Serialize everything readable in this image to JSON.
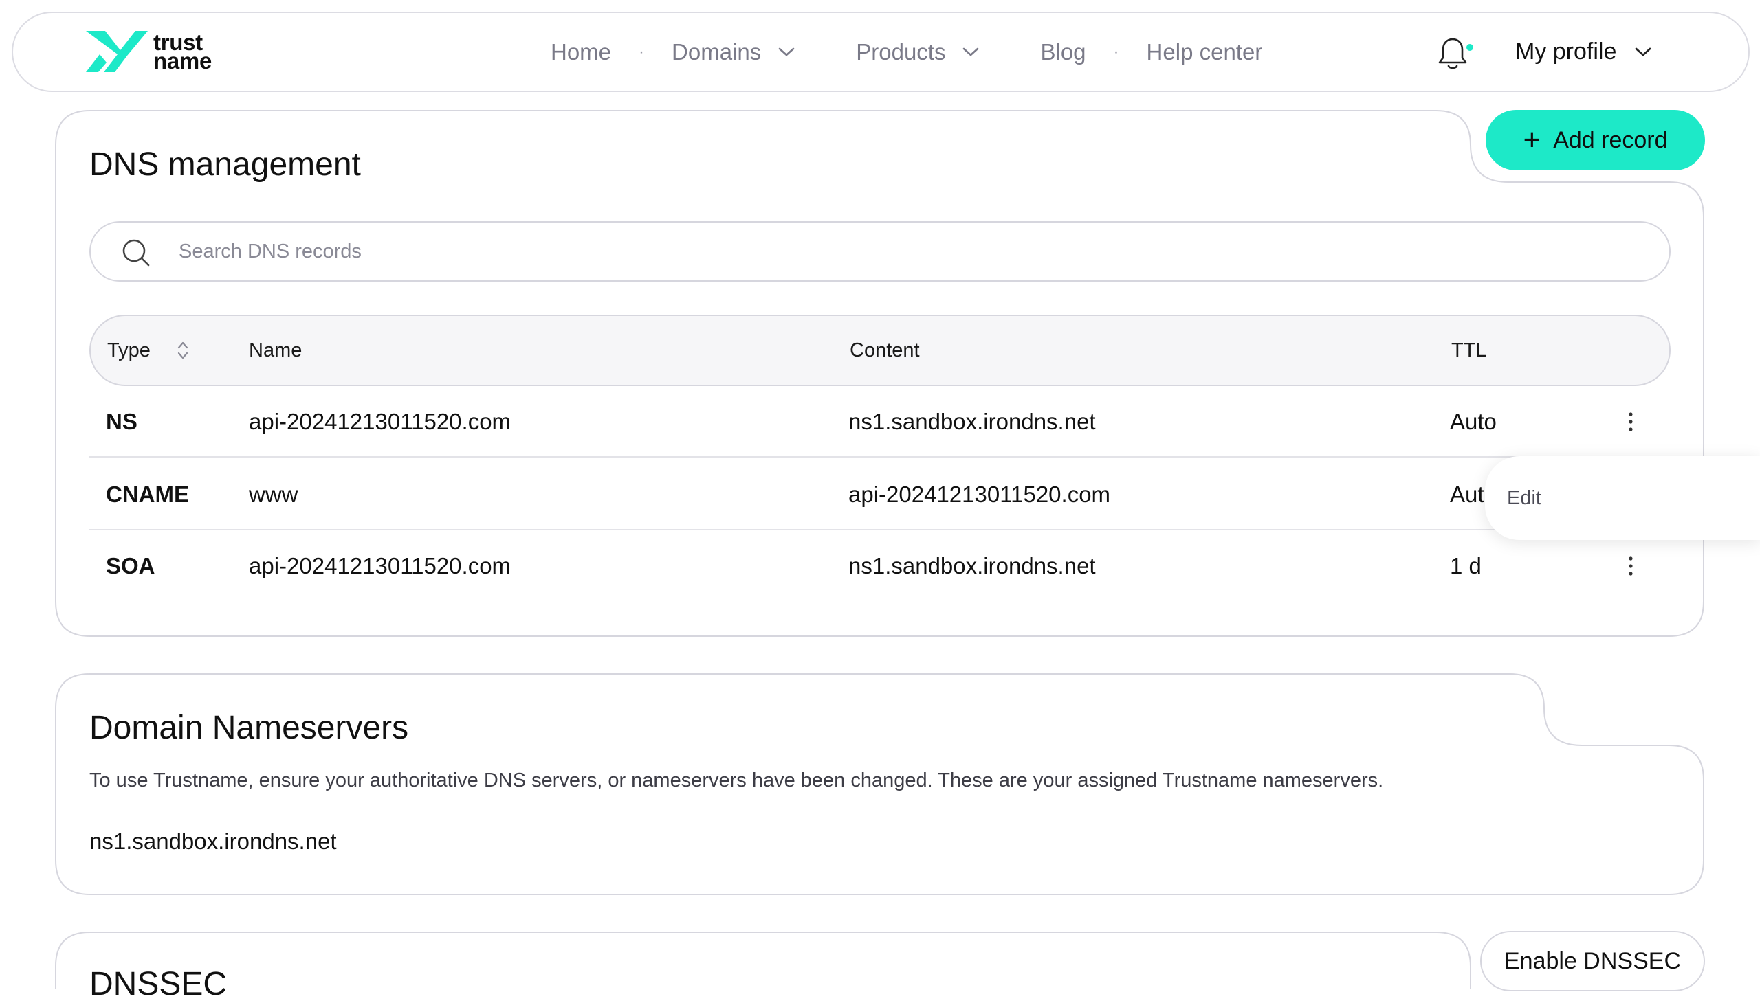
{
  "brand": {
    "logo_top": "trust",
    "logo_bottom": "name",
    "accent": "#1de9c8"
  },
  "nav": {
    "items": [
      {
        "label": "Home"
      },
      {
        "label": "Domains"
      },
      {
        "label": "Products"
      },
      {
        "label": "Blog"
      },
      {
        "label": "Help center"
      }
    ],
    "profile_label": "My profile"
  },
  "dns": {
    "title": "DNS management",
    "add_label": "Add record",
    "search_placeholder": "Search DNS records",
    "columns": {
      "type": "Type",
      "name": "Name",
      "content": "Content",
      "ttl": "TTL"
    },
    "rows": [
      {
        "type": "NS",
        "name": "api-20241213011520.com",
        "content": "ns1.sandbox.irondns.net",
        "ttl": "Auto"
      },
      {
        "type": "CNAME",
        "name": "www",
        "content": "api-20241213011520.com",
        "ttl": "Aut"
      },
      {
        "type": "SOA",
        "name": "api-20241213011520.com",
        "content": "ns1.sandbox.irondns.net",
        "ttl": "1 d"
      }
    ],
    "menu_edit": "Edit"
  },
  "nameservers": {
    "title": "Domain Nameservers",
    "description": "To use Trustname, ensure your authoritative DNS servers, or nameservers have been changed. These are your assigned Trustname nameservers.",
    "servers": [
      "ns1.sandbox.irondns.net"
    ]
  },
  "dnssec": {
    "title": "DNSSEC",
    "enable_label": "Enable DNSSEC"
  }
}
